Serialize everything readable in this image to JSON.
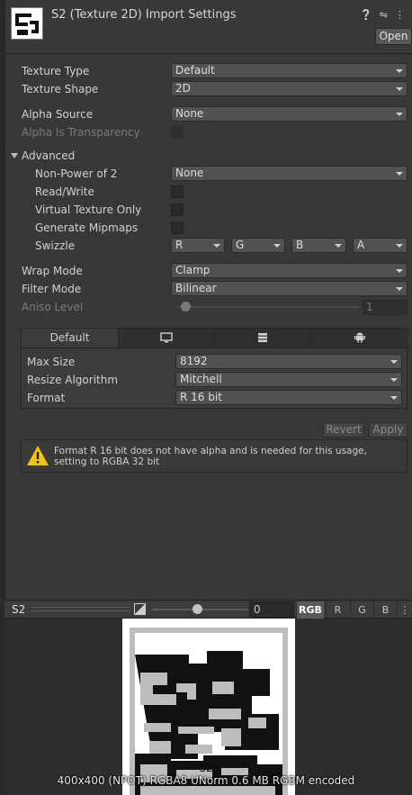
{
  "header": {
    "title": "S2 (Texture 2D) Import Settings",
    "open_label": "Open"
  },
  "fields": {
    "texture_type": {
      "label": "Texture Type",
      "value": "Default"
    },
    "texture_shape": {
      "label": "Texture Shape",
      "value": "2D"
    },
    "alpha_source": {
      "label": "Alpha Source",
      "value": "None"
    },
    "alpha_is_transparency": {
      "label": "Alpha Is Transparency"
    },
    "advanced": {
      "label": "Advanced"
    },
    "non_power_of_2": {
      "label": "Non-Power of 2",
      "value": "None"
    },
    "read_write": {
      "label": "Read/Write"
    },
    "virtual_texture_only": {
      "label": "Virtual Texture Only"
    },
    "generate_mipmaps": {
      "label": "Generate Mipmaps"
    },
    "swizzle": {
      "label": "Swizzle",
      "values": [
        "R",
        "G",
        "B",
        "A"
      ]
    },
    "wrap_mode": {
      "label": "Wrap Mode",
      "value": "Clamp"
    },
    "filter_mode": {
      "label": "Filter Mode",
      "value": "Bilinear"
    },
    "aniso_level": {
      "label": "Aniso Level",
      "value": "1"
    }
  },
  "platform": {
    "tabs": [
      {
        "label": "Default",
        "icon": null
      },
      {
        "label": "",
        "icon": "monitor-icon"
      },
      {
        "label": "",
        "icon": "server-icon"
      },
      {
        "label": "",
        "icon": "android-icon"
      }
    ],
    "max_size": {
      "label": "Max Size",
      "value": "8192"
    },
    "resize_algorithm": {
      "label": "Resize Algorithm",
      "value": "Mitchell"
    },
    "format": {
      "label": "Format",
      "value": "R 16 bit"
    }
  },
  "actions": {
    "revert": "Revert",
    "apply": "Apply"
  },
  "warning": {
    "icon": "warning-icon",
    "text": "Format R 16 bit does not have alpha and is needed for this usage, setting to RGBA 32 bit"
  },
  "preview": {
    "name": "S2",
    "mip_value": "0",
    "channels": [
      "RGB",
      "R",
      "G",
      "B"
    ],
    "texture_label": "S2",
    "info": "400x400 (NPOT)  RGBA8 UNorm   0.6 MB   RGBM encoded"
  },
  "colors": {
    "background": "#383838",
    "warning_yellow": "#f0c21e",
    "field": "#515151"
  }
}
